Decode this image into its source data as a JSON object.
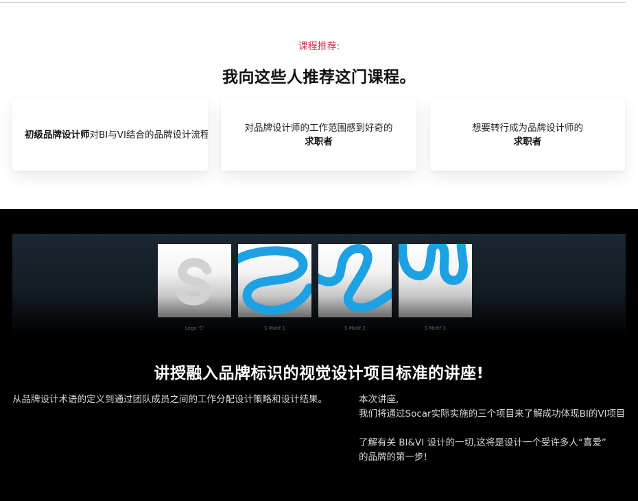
{
  "section_recommend": {
    "eyebrow": "课程推荐:",
    "heading": "我向这些人推荐这门课程。",
    "cards": [
      {
        "bold": "初级品牌设计师",
        "text": "对BI与VI结合的品牌设计流程感兴趣的人"
      },
      {
        "line1": "对品牌设计师的工作范围感到好奇的",
        "line2": "求职者"
      },
      {
        "line1": "想要转行成为品牌设计师的",
        "line2": "求职者"
      }
    ]
  },
  "section_lecture": {
    "tiles": [
      {
        "caption": "Logo 'S'",
        "icon": "s-letter-logo"
      },
      {
        "caption": "S Motif 1",
        "icon": "s-motif-blue-curve"
      },
      {
        "caption": "S Motif 2",
        "icon": "s-motif-blue-curve"
      },
      {
        "caption": "S Motif 3",
        "icon": "s-motif-blue-curve"
      }
    ],
    "title": "讲授融入品牌标识的视觉设计项目标准的讲座!",
    "left_text": "从品牌设计术语的定义到通过团队成员之间的工作分配设计策略和设计结果。",
    "right_lines": [
      "本次讲座,",
      "我们将通过Socar实际实施的三个项目来了解成功体现BI的VI项目",
      "了解有关 BI&VI 设计的一切,这将是设计一个受许多人“喜爱”",
      "的品牌的第一步!"
    ]
  },
  "colors": {
    "accent": "#d4394f",
    "motif_blue": "#1ea1e3",
    "dark_bg": "#000000"
  }
}
